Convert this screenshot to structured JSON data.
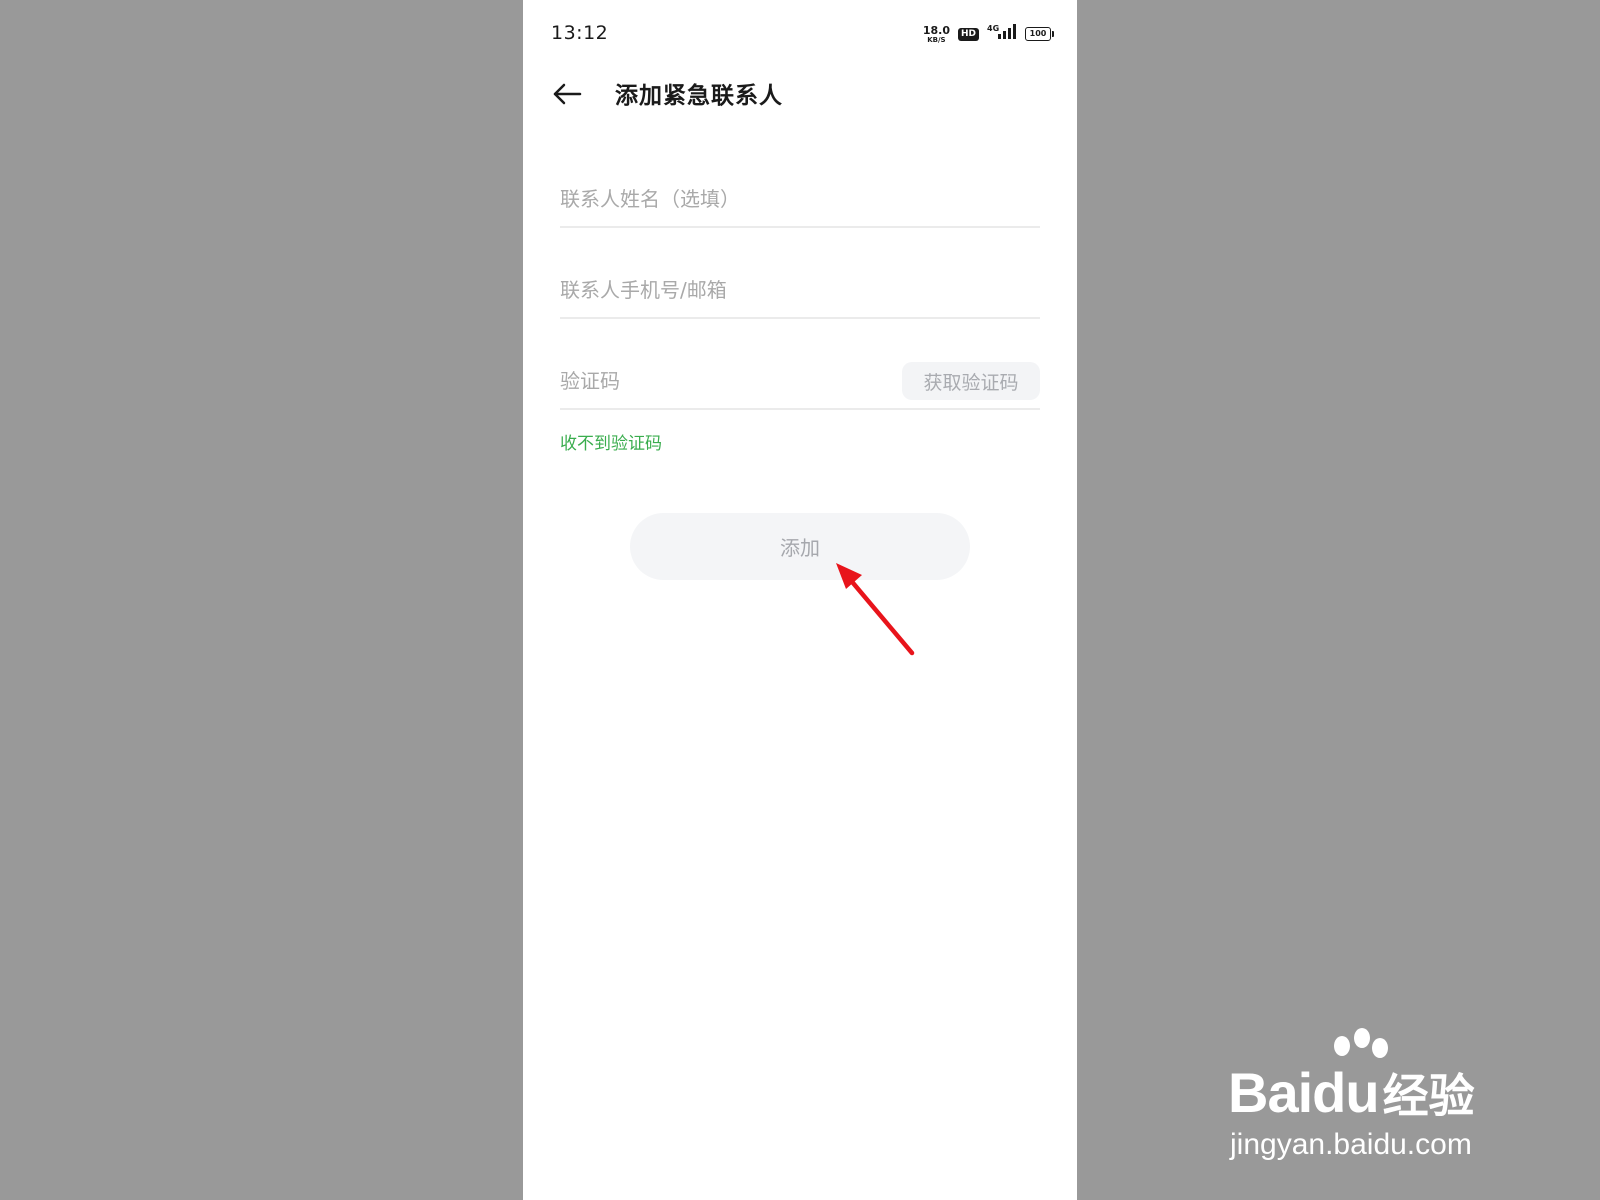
{
  "status_bar": {
    "time": "13:12",
    "net_speed": "18.0",
    "net_speed_unit": "KB/S",
    "hd": "HD",
    "network_type": "4G",
    "battery": "100"
  },
  "header": {
    "title": "添加紧急联系人",
    "back_icon": "arrow-left-icon"
  },
  "form": {
    "name_placeholder": "联系人姓名（选填）",
    "name_value": "",
    "contact_placeholder": "联系人手机号/邮箱",
    "contact_value": "",
    "code_placeholder": "验证码",
    "code_value": "",
    "get_code_label": "获取验证码",
    "no_code_label": "收不到验证码",
    "submit_label": "添加"
  },
  "colors": {
    "accent_link": "#3aad4e",
    "disabled_text": "#a6a8ad",
    "annotation": "#e8141b",
    "backdrop": "#999999"
  },
  "watermark": {
    "brand": "Bai",
    "brand_tail": "du",
    "brand_cn": "经验",
    "url": "jingyan.baidu.com"
  }
}
